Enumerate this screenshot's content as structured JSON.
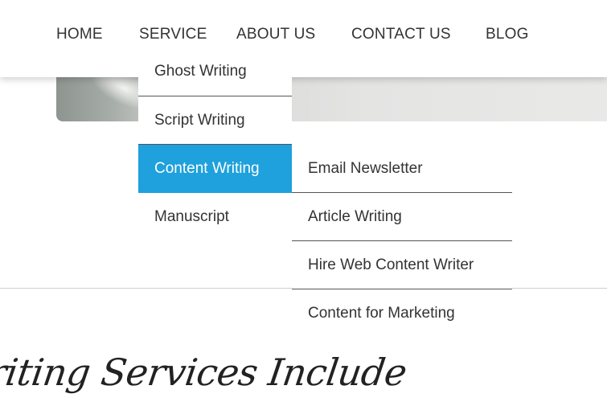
{
  "nav": {
    "home": "HOME",
    "service": "SERVICE",
    "about": "ABOUT US",
    "contact": "CONTACT US",
    "blog": "BLOG"
  },
  "service_menu": {
    "items": [
      {
        "label": "Ghost Writing"
      },
      {
        "label": "Script Writing"
      },
      {
        "label": "Content Writing",
        "active": true
      },
      {
        "label": "Manuscript"
      }
    ]
  },
  "content_writing_submenu": {
    "items": [
      {
        "label": "Email Newsletter"
      },
      {
        "label": "Article Writing"
      },
      {
        "label": "Hire Web Content Writer"
      },
      {
        "label": "Content for Marketing"
      }
    ]
  },
  "section": {
    "heading": "riting Services Include"
  },
  "colors": {
    "active_menu_bg": "#1ea1dc",
    "active_menu_text": "#ffffff",
    "menu_text": "#333333"
  }
}
